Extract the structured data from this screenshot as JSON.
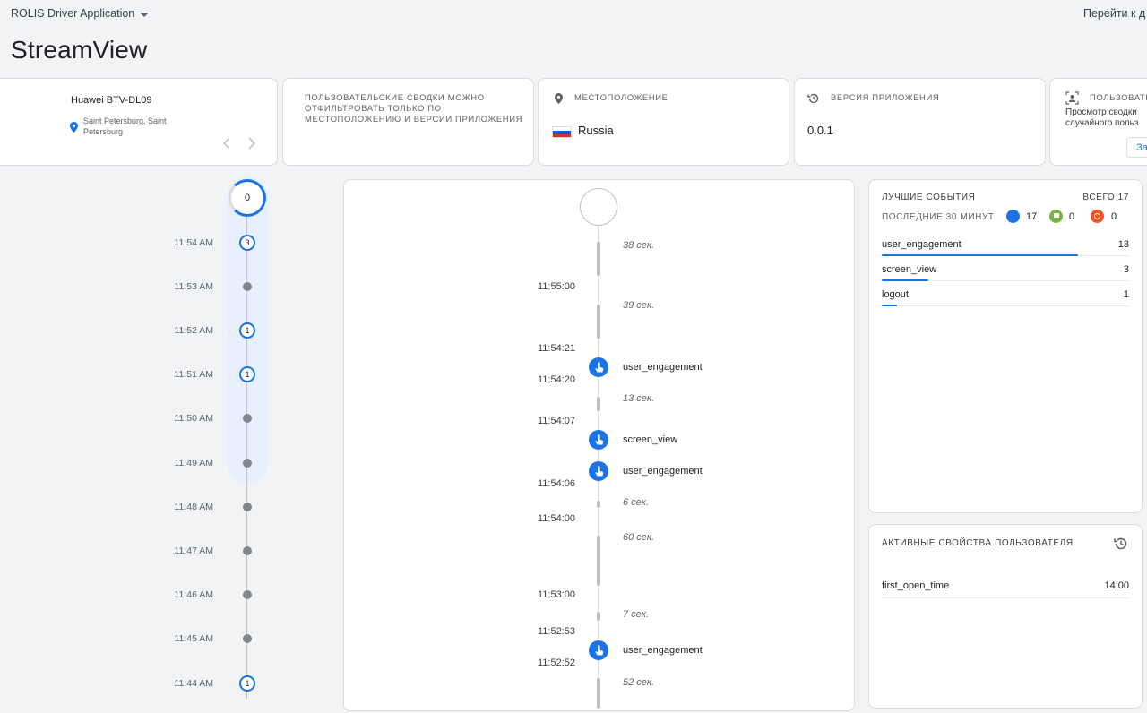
{
  "header": {
    "app_name": "ROLIS Driver Application",
    "goto_label": "Перейти к д",
    "page_title": "StreamView"
  },
  "device_card": {
    "device": "Huawei BTV-DL09",
    "location_line1": "Saint Petersburg, Saint",
    "location_line2": "Petersburg"
  },
  "info_card": {
    "text_line1": "ПОЛЬЗОВАТЕЛЬСКИЕ СВОДКИ МОЖНО",
    "text_line2": "ОТФИЛЬТРОВАТЬ ТОЛЬКО ПО",
    "text_line3": "МЕСТОПОЛОЖЕНИЮ И ВЕРСИИ ПРИЛОЖЕНИЯ"
  },
  "location_card": {
    "title": "МЕСТОПОЛОЖЕНИЕ",
    "value": "Russia"
  },
  "version_card": {
    "title": "ВЕРСИЯ ПРИЛОЖЕНИЯ",
    "value": "0.0.1"
  },
  "user_card": {
    "title": "ПОЛЬЗОВАТЕ",
    "text_line1": "Просмотр сводки",
    "text_line2": "случайного польз",
    "button": "За"
  },
  "timeline": {
    "top_count": "0",
    "rows": [
      {
        "time": "11:54 AM",
        "count": "3"
      },
      {
        "time": "11:53 AM",
        "count": ""
      },
      {
        "time": "11:52 AM",
        "count": "1"
      },
      {
        "time": "11:51 AM",
        "count": "1"
      },
      {
        "time": "11:50 AM",
        "count": ""
      },
      {
        "time": "11:49 AM",
        "count": ""
      },
      {
        "time": "11:48 AM",
        "count": ""
      },
      {
        "time": "11:47 AM",
        "count": ""
      },
      {
        "time": "11:46 AM",
        "count": ""
      },
      {
        "time": "11:45 AM",
        "count": ""
      },
      {
        "time": "11:44 AM",
        "count": "1"
      }
    ]
  },
  "stream": {
    "durations": [
      "38 сек.",
      "39 сек.",
      "13 сек.",
      "6 сек.",
      "60 сек.",
      "7 сек.",
      "52 сек."
    ],
    "times": [
      "11:55:00",
      "11:54:21",
      "11:54:20",
      "11:54:07",
      "11:54:06",
      "11:54:00",
      "11:53:00",
      "11:52:53",
      "11:52:52"
    ],
    "events": [
      "user_engagement",
      "screen_view",
      "user_engagement",
      "user_engagement"
    ]
  },
  "top_events": {
    "title": "ЛУЧШИЕ СОБЫТИЯ",
    "total": "ВСЕГО 17",
    "period": "ПОСЛЕДНИЕ 30 МИНУТ",
    "counts": {
      "blue": "17",
      "green": "0",
      "orange": "0"
    },
    "items": [
      {
        "name": "user_engagement",
        "count": "13",
        "share": 0.76
      },
      {
        "name": "screen_view",
        "count": "3",
        "share": 0.18
      },
      {
        "name": "logout",
        "count": "1",
        "share": 0.06
      }
    ]
  },
  "user_props": {
    "title": "АКТИВНЫЕ СВОЙСТВА ПОЛЬЗОВАТЕЛЯ",
    "items": [
      {
        "name": "first_open_time",
        "value": "14:00"
      }
    ]
  },
  "colors": {
    "accent": "#1a73e8",
    "green": "#7cb342",
    "orange": "#f4511e"
  }
}
